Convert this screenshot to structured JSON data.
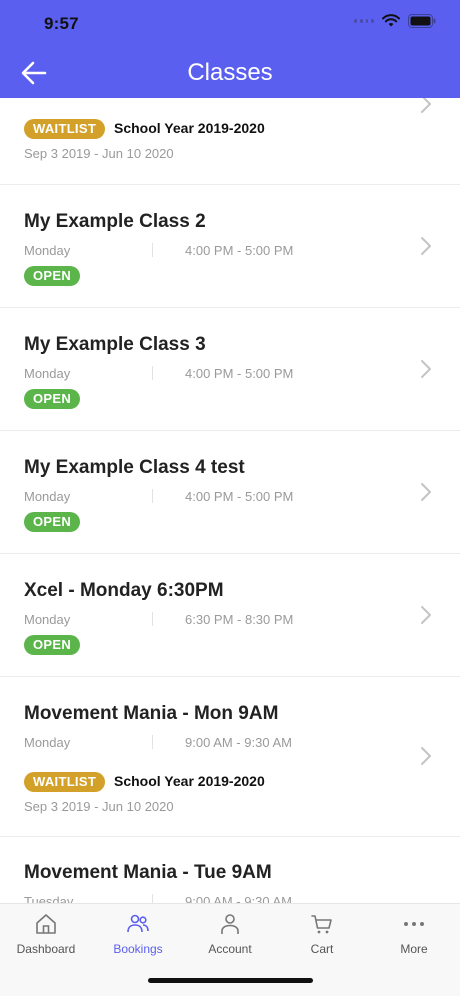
{
  "status_bar": {
    "time": "9:57"
  },
  "header": {
    "title": "Classes"
  },
  "top_partial": {
    "badge": "WAITLIST",
    "season": "School Year 2019-2020",
    "range": "Sep 3 2019 - Jun 10 2020"
  },
  "items": [
    {
      "title": "My Example Class 2",
      "day": "Monday",
      "time": "4:00 PM - 5:00 PM",
      "badge": "OPEN"
    },
    {
      "title": "My Example Class 3",
      "day": "Monday",
      "time": "4:00 PM - 5:00 PM",
      "badge": "OPEN"
    },
    {
      "title": "My Example Class 4 test",
      "day": "Monday",
      "time": "4:00 PM - 5:00 PM",
      "badge": "OPEN"
    },
    {
      "title": "Xcel - Monday 6:30PM",
      "day": "Monday",
      "time": "6:30 PM - 8:30 PM",
      "badge": "OPEN"
    },
    {
      "title": "Movement Mania - Mon 9AM",
      "day": "Monday",
      "time": "9:00 AM - 9:30 AM",
      "badge": "WAITLIST",
      "season": "School Year 2019-2020",
      "range": "Sep 3 2019 - Jun 10 2020"
    },
    {
      "title": "Movement Mania - Tue 9AM",
      "day": "Tuesday",
      "time": "9:00 AM - 9:30 AM"
    }
  ],
  "tabbar": {
    "tabs": [
      {
        "label": "Dashboard",
        "icon": "home-icon"
      },
      {
        "label": "Bookings",
        "icon": "people-icon",
        "active": true
      },
      {
        "label": "Account",
        "icon": "person-icon"
      },
      {
        "label": "Cart",
        "icon": "cart-icon"
      },
      {
        "label": "More",
        "icon": "more-icon"
      }
    ]
  },
  "colors": {
    "accent": "#5b5ff0",
    "open": "#5bb54b",
    "waitlist": "#d3a12a"
  }
}
